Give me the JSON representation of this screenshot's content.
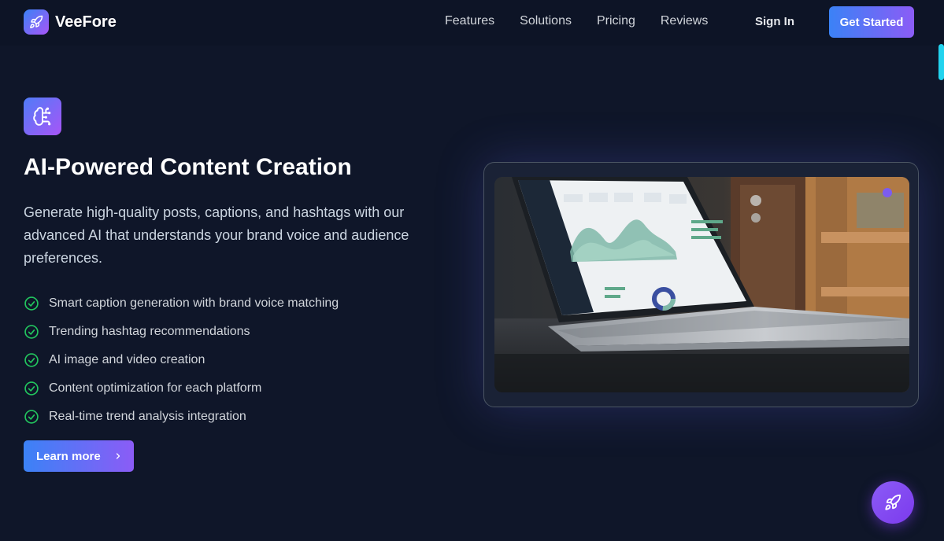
{
  "nav": {
    "brand": "VeeFore",
    "links": [
      "Features",
      "Solutions",
      "Pricing",
      "Reviews"
    ],
    "sign_in": "Sign In",
    "cta": "Get Started"
  },
  "hero": {
    "icon": "brain-circuit-icon",
    "title": "AI-Powered Content Creation",
    "description": "Generate high-quality posts, captions, and hashtags with our advanced AI that understands your brand voice and audience preferences.",
    "features": [
      "Smart caption generation with brand voice matching",
      "Trending hashtag recommendations",
      "AI image and video creation",
      "Content optimization for each platform",
      "Real-time trend analysis integration"
    ],
    "button": "Learn more"
  },
  "colors": {
    "background": "#0f1629",
    "accent_start": "#3b82f6",
    "accent_end": "#a855f7",
    "check": "#22c55e"
  }
}
